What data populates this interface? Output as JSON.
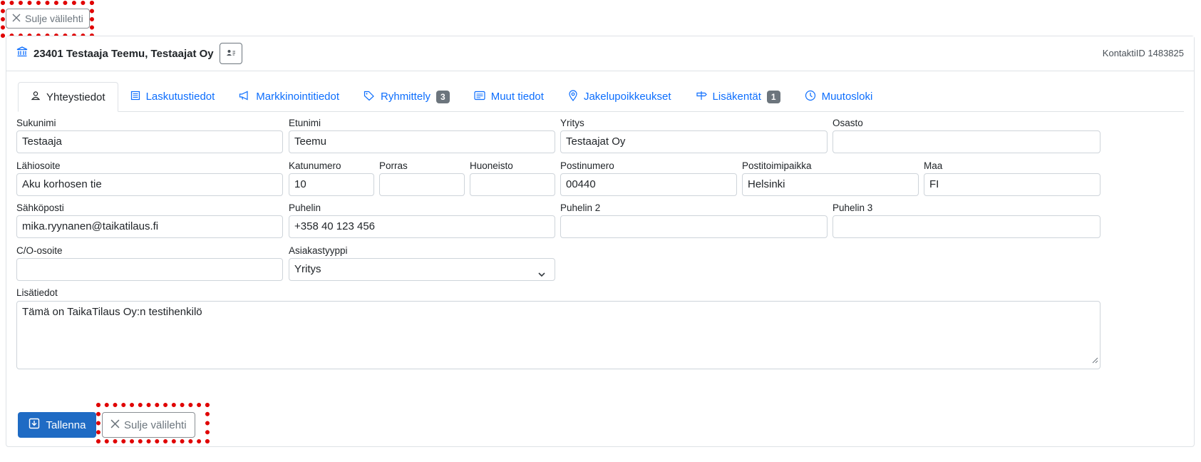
{
  "close_tab_label": "Sulje välilehti",
  "header": {
    "title": "23401 Testaaja Teemu, Testaajat Oy",
    "contact_id": "KontaktiID 1483825"
  },
  "tabs": [
    {
      "label": "Yhteystiedot",
      "icon": "person-icon",
      "active": true
    },
    {
      "label": "Laskutustiedot",
      "icon": "receipt-icon"
    },
    {
      "label": "Markkinointitiedot",
      "icon": "megaphone-icon"
    },
    {
      "label": "Ryhmittely",
      "icon": "tags-icon",
      "badge": "3"
    },
    {
      "label": "Muut tiedot",
      "icon": "card-text-icon"
    },
    {
      "label": "Jakelupoikkeukset",
      "icon": "geo-pin-icon"
    },
    {
      "label": "Lisäkentät",
      "icon": "signpost-icon",
      "badge": "1"
    },
    {
      "label": "Muutosloki",
      "icon": "clock-icon"
    }
  ],
  "fields": {
    "sukunimi": {
      "label": "Sukunimi",
      "value": "Testaaja"
    },
    "etunimi": {
      "label": "Etunimi",
      "value": "Teemu"
    },
    "yritys": {
      "label": "Yritys",
      "value": "Testaajat Oy"
    },
    "osasto": {
      "label": "Osasto",
      "value": ""
    },
    "lahiosoite": {
      "label": "Lähiosoite",
      "value": "Aku korhosen tie"
    },
    "katunumero": {
      "label": "Katunumero",
      "value": "10"
    },
    "porras": {
      "label": "Porras",
      "value": ""
    },
    "huoneisto": {
      "label": "Huoneisto",
      "value": ""
    },
    "postinumero": {
      "label": "Postinumero",
      "value": "00440"
    },
    "postitoimipaikka": {
      "label": "Postitoimipaikka",
      "value": "Helsinki"
    },
    "maa": {
      "label": "Maa",
      "value": "FI"
    },
    "sahkoposti": {
      "label": "Sähköposti",
      "value": "mika.ryynanen@taikatilaus.fi"
    },
    "puhelin": {
      "label": "Puhelin",
      "value": "+358 40 123 456"
    },
    "puhelin2": {
      "label": "Puhelin 2",
      "value": ""
    },
    "puhelin3": {
      "label": "Puhelin 3",
      "value": ""
    },
    "co_osoite": {
      "label": "C/O-osoite",
      "value": ""
    },
    "asiakastyyppi": {
      "label": "Asiakastyyppi",
      "value": "Yritys"
    },
    "lisatiedot": {
      "label": "Lisätiedot",
      "value": "Tämä on TaikaTilaus Oy:n testihenkilö"
    }
  },
  "actions": {
    "save_label": "Tallenna"
  },
  "colors": {
    "primary": "#1f6bc4",
    "link": "#0d6efd",
    "badge": "#6c757d",
    "highlight": "#e00000"
  }
}
